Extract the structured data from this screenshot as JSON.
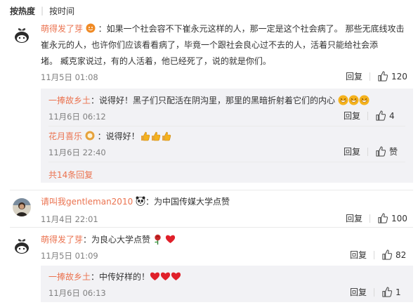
{
  "sort": {
    "active": "按热度",
    "other": "按时间"
  },
  "colors": {
    "username": "#eb7350",
    "subbox_bg": "#f2f2f5"
  },
  "comments": [
    {
      "user": "萌得发了芽",
      "text_lines": [
        "：如果一个社会容不下崔永元这样的人，那一定是这个社会病了。  那些无底线攻击",
        "崔永元的人，也许你们应该看看病了，毕竟一个跟社会良心过不去的人，活着只能给社会添",
        "堵。  臧克家说过，有的人活着，他已经死了，说的就是你们。"
      ],
      "time": "11月5日 01:08",
      "reply_label": "回复",
      "likes": "120",
      "replies": [
        {
          "user": "一捧故乡土",
          "text": "：说得好！黑子们只配活在阴沟里，那里的黑暗折射着它们的内心",
          "time": "11月6日 06:12",
          "reply_label": "回复",
          "likes": "4"
        },
        {
          "user": "花月喜乐",
          "text": "：说得好！",
          "time": "11月6日 22:40",
          "reply_label": "回复",
          "likes": "赞"
        }
      ],
      "more_replies": "共14条回复"
    },
    {
      "user": "请叫我gentleman2010",
      "text": "：为中国传媒大学点赞",
      "time": "11月4日 22:01",
      "reply_label": "回复",
      "likes": "100"
    },
    {
      "user": "萌得发了芽",
      "text": "：为良心大学点赞",
      "time": "11月5日 01:09",
      "reply_label": "回复",
      "likes": "82",
      "replies": [
        {
          "user": "一捧故乡土",
          "text": "：中传好样的！",
          "time": "11月6日 06:13",
          "reply_label": "回复",
          "likes": "1"
        }
      ]
    }
  ],
  "icons": [
    "thumb-up-icon",
    "grin-emoji-icon",
    "thumbs-up-emoji-icon",
    "heart-emoji-icon",
    "rose-emoji-icon",
    "panda-emoji-icon",
    "vip-badge-icon"
  ]
}
